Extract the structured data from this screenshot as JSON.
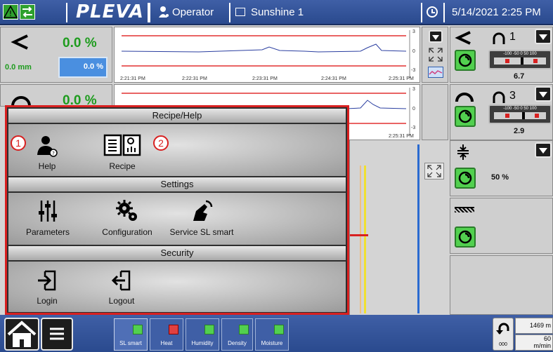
{
  "header": {
    "brand": "PLEVA",
    "user": "Operator",
    "recipe": "Sunshine 1",
    "datetime": "5/14/2021 2:25 PM"
  },
  "left_panels": [
    {
      "value": "0.0 %",
      "sub_value": "0.0 mm",
      "input_value": "0.0 %"
    },
    {
      "value": "0.0 %"
    }
  ],
  "trend1": {
    "times": [
      "2:21:31 PM",
      "2:22:31 PM",
      "2:23:31 PM",
      "2:24:31 PM",
      "2:25:31 PM"
    ],
    "yticks": [
      "3",
      "0",
      "-3"
    ]
  },
  "trend2": {
    "times": [
      "2:25:31 PM"
    ],
    "yticks": [
      "3",
      "0",
      "-3"
    ]
  },
  "right_panels": [
    {
      "number": "1",
      "scale": "-100 -50 0 50 100",
      "value": "6.7"
    },
    {
      "number": "3",
      "scale": "-100 -50 0 50 100",
      "value": "2.9"
    },
    {
      "value": "50 %"
    }
  ],
  "menu": {
    "sections": [
      {
        "title": "Recipe/Help",
        "items": [
          {
            "label": "Help",
            "callout": "1"
          },
          {
            "label": "Recipe",
            "callout": "2"
          }
        ]
      },
      {
        "title": "Settings",
        "items": [
          {
            "label": "Parameters"
          },
          {
            "label": "Configuration"
          },
          {
            "label": "Service SL smart"
          }
        ]
      },
      {
        "title": "Security",
        "items": [
          {
            "label": "Login"
          },
          {
            "label": "Logout"
          }
        ]
      }
    ]
  },
  "bottom": {
    "tabs": [
      "SL smart",
      "Heat",
      "Humidity",
      "Density",
      "Moisture"
    ],
    "counter": "000",
    "length": "1469 m",
    "speed_value": "60",
    "speed_unit": "m/min"
  },
  "colors": {
    "accent": "#3f5fa6",
    "green": "#1e9c1e",
    "callout": "#d82020"
  }
}
